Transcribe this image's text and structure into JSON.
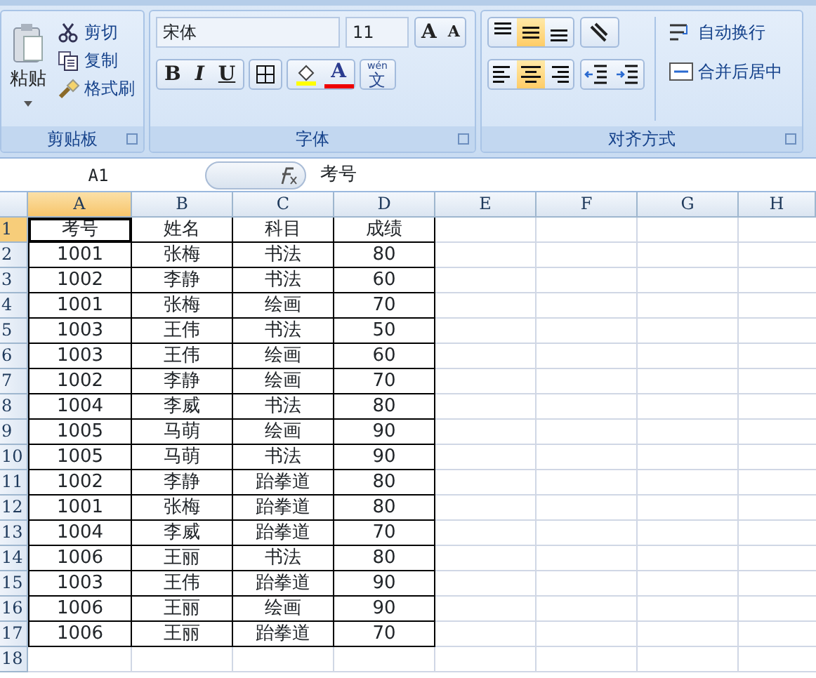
{
  "clipboard": {
    "paste": "粘贴",
    "items": [
      {
        "kind": "cut",
        "label": "剪切"
      },
      {
        "kind": "copy",
        "label": "复制"
      },
      {
        "kind": "painter",
        "label": "格式刷"
      }
    ],
    "label": "剪贴板"
  },
  "font": {
    "name": "宋体",
    "size": "11",
    "grow": "A",
    "shrink": "A",
    "bold": "B",
    "italic": "I",
    "underline": "U",
    "font_color": "A",
    "phonetic": "文",
    "phonetic_top": "wén",
    "label": "字体"
  },
  "alignment": {
    "vertical": [
      {
        "kind": "top",
        "selected": false
      },
      {
        "kind": "middle",
        "selected": true
      },
      {
        "kind": "bottom",
        "selected": false
      }
    ],
    "horizontal": [
      {
        "kind": "left",
        "selected": false
      },
      {
        "kind": "center",
        "selected": true
      },
      {
        "kind": "right",
        "selected": false
      }
    ],
    "wrap": "自动换行",
    "merge": "合并后居中",
    "label": "对齐方式"
  },
  "formula_bar": {
    "name_box": "A1",
    "formula": "考号"
  },
  "sheet": {
    "columns": [
      {
        "label": "A",
        "selected": true
      },
      {
        "label": "B",
        "selected": false
      },
      {
        "label": "C",
        "selected": false
      },
      {
        "label": "D",
        "selected": false
      },
      {
        "label": "E",
        "selected": false
      },
      {
        "label": "F",
        "selected": false
      },
      {
        "label": "G",
        "selected": false
      },
      {
        "label": "H",
        "selected": false
      }
    ],
    "rows": [
      {
        "label": "1",
        "selected": true,
        "cells": [
          "考号",
          "姓名",
          "科目",
          "成绩"
        ]
      },
      {
        "label": "2",
        "selected": false,
        "cells": [
          "1001",
          "张梅",
          "书法",
          "80"
        ]
      },
      {
        "label": "3",
        "selected": false,
        "cells": [
          "1002",
          "李静",
          "书法",
          "60"
        ]
      },
      {
        "label": "4",
        "selected": false,
        "cells": [
          "1001",
          "张梅",
          "绘画",
          "70"
        ]
      },
      {
        "label": "5",
        "selected": false,
        "cells": [
          "1003",
          "王伟",
          "书法",
          "50"
        ]
      },
      {
        "label": "6",
        "selected": false,
        "cells": [
          "1003",
          "王伟",
          "绘画",
          "60"
        ]
      },
      {
        "label": "7",
        "selected": false,
        "cells": [
          "1002",
          "李静",
          "绘画",
          "70"
        ]
      },
      {
        "label": "8",
        "selected": false,
        "cells": [
          "1004",
          "李威",
          "书法",
          "80"
        ]
      },
      {
        "label": "9",
        "selected": false,
        "cells": [
          "1005",
          "马萌",
          "绘画",
          "90"
        ]
      },
      {
        "label": "10",
        "selected": false,
        "cells": [
          "1005",
          "马萌",
          "书法",
          "90"
        ]
      },
      {
        "label": "11",
        "selected": false,
        "cells": [
          "1002",
          "李静",
          "跆拳道",
          "80"
        ]
      },
      {
        "label": "12",
        "selected": false,
        "cells": [
          "1001",
          "张梅",
          "跆拳道",
          "80"
        ]
      },
      {
        "label": "13",
        "selected": false,
        "cells": [
          "1004",
          "李威",
          "跆拳道",
          "70"
        ]
      },
      {
        "label": "14",
        "selected": false,
        "cells": [
          "1006",
          "王丽",
          "书法",
          "80"
        ]
      },
      {
        "label": "15",
        "selected": false,
        "cells": [
          "1003",
          "王伟",
          "跆拳道",
          "90"
        ]
      },
      {
        "label": "16",
        "selected": false,
        "cells": [
          "1006",
          "王丽",
          "绘画",
          "90"
        ]
      },
      {
        "label": "17",
        "selected": false,
        "cells": [
          "1006",
          "王丽",
          "跆拳道",
          "70"
        ]
      },
      {
        "label": "18",
        "selected": false,
        "cells": []
      }
    ]
  }
}
